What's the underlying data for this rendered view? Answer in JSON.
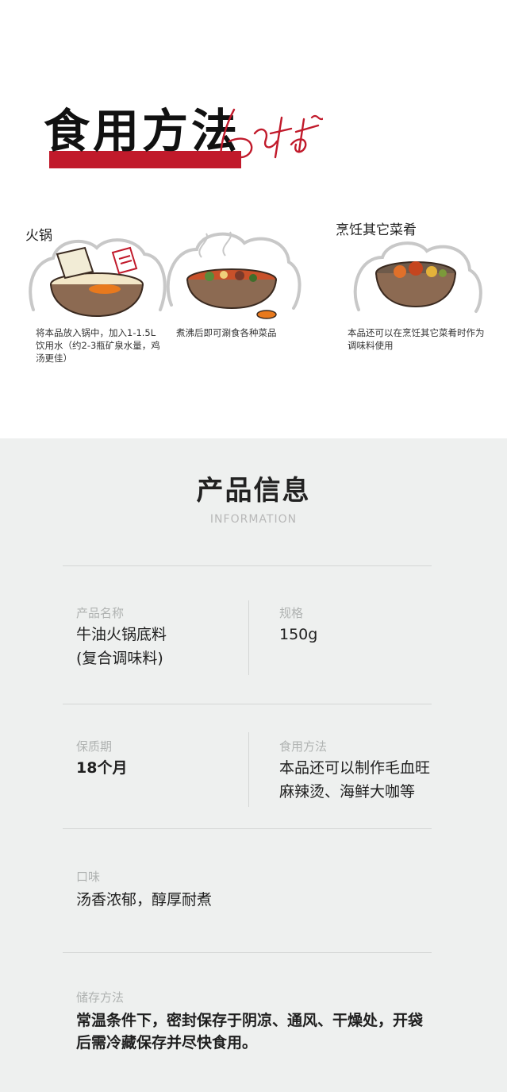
{
  "usage": {
    "title": "食用方法",
    "script_word": "latest~",
    "colors": {
      "accent_red": "#c11a2b",
      "ink": "#111111"
    },
    "steps": [
      {
        "heading": "火锅",
        "caption": "将本品放入锅中，加入1-1.5L饮用水（约2-3瓶矿泉水量，鸡汤更佳）"
      },
      {
        "heading": "",
        "caption": "煮沸后即可涮食各种菜品"
      },
      {
        "heading": "烹饪其它菜肴",
        "caption": "本品还可以在烹饪其它菜肴时作为调味料使用"
      }
    ]
  },
  "info": {
    "title": "产品信息",
    "subtitle": "INFORMATION",
    "fields": {
      "name": {
        "label": "产品名称",
        "value_line1": "牛油火锅底料",
        "value_line2": "(复合调味料)"
      },
      "spec": {
        "label": "规格",
        "value": "150g"
      },
      "shelf": {
        "label": "保质期",
        "value": "18个月"
      },
      "method": {
        "label": "食用方法",
        "value_line1": "本品还可以制作毛血旺",
        "value_line2": "麻辣烫、海鲜大咖等"
      },
      "taste": {
        "label": "口味",
        "value": "汤香浓郁，醇厚耐煮"
      },
      "storage": {
        "label": "储存方法",
        "value_line1": "常温条件下，密封保存于阴凉、通风、干燥处，开袋",
        "value_line2": "后需冷藏保存并尽快食用。"
      }
    },
    "colors": {
      "background": "#eef0ef",
      "divider": "#d4d6d5",
      "label": "#b0b3b2"
    }
  }
}
